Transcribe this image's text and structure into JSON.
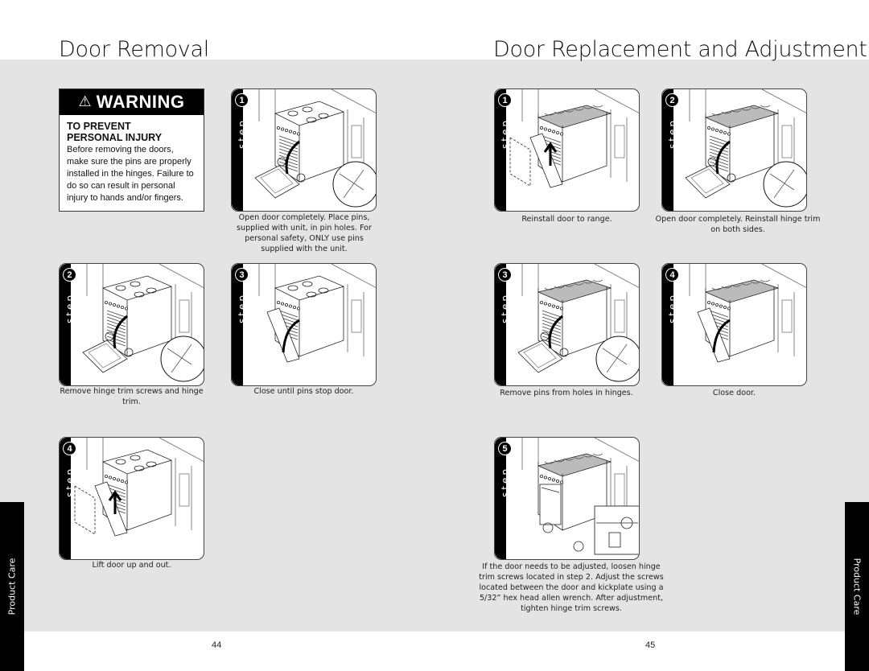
{
  "left_page": {
    "title": "Door Removal",
    "page_number": "44",
    "side_tab": "Product Care",
    "warning": {
      "heading": "WARNING",
      "icon": "warning-triangle-icon",
      "subheading_line1": "TO PREVENT",
      "subheading_line2": "PERSONAL INJURY",
      "text": "Before removing the doors, make sure the pins are properly installed in the hinges. Failure to do so can result in personal injury to hands and/or fingers."
    },
    "steps": [
      {
        "number": "1",
        "label": "step",
        "caption": "Open door completely. Place pins, supplied with unit, in pin holes. For personal safety, ONLY use pins supplied with the unit."
      },
      {
        "number": "2",
        "label": "step",
        "caption": "Remove hinge trim screws and hinge trim."
      },
      {
        "number": "3",
        "label": "step",
        "caption": "Close until pins stop door."
      },
      {
        "number": "4",
        "label": "step",
        "caption": "Lift door up and out."
      }
    ]
  },
  "right_page": {
    "title": "Door Replacement and Adjustment",
    "page_number": "45",
    "side_tab": "Product Care",
    "steps": [
      {
        "number": "1",
        "label": "step",
        "caption": "Reinstall door to range."
      },
      {
        "number": "2",
        "label": "step",
        "caption": "Open door completely. Reinstall hinge trim on both sides."
      },
      {
        "number": "3",
        "label": "step",
        "caption": "Remove pins from holes in hinges."
      },
      {
        "number": "4",
        "label": "step",
        "caption": "Close door."
      },
      {
        "number": "5",
        "label": "step",
        "caption": "If the door needs to be adjusted, loosen hinge trim screws located in step 2. Adjust the screws located between the door and kickplate using a 5/32” hex head allen wrench. After adjustment, tighten hinge trim screws."
      }
    ]
  }
}
